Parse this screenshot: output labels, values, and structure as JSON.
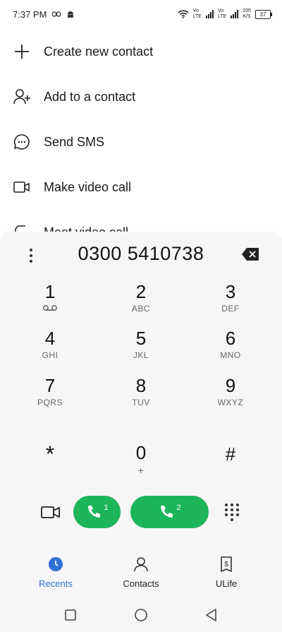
{
  "status_bar": {
    "time": "7:37 PM",
    "volte1": "Vo",
    "lte1": "LTE",
    "volte2": "Vo",
    "lte2": "LTE",
    "speed": "205",
    "speed_unit": "K/S",
    "battery": "37"
  },
  "menu": {
    "items": [
      {
        "label": "Create new contact",
        "icon": "plus-icon"
      },
      {
        "label": "Add to a contact",
        "icon": "add-person-icon"
      },
      {
        "label": "Send SMS",
        "icon": "chat-bubble-icon"
      },
      {
        "label": "Make video call",
        "icon": "video-camera-icon"
      },
      {
        "label": "Meet video call",
        "icon": "meet-video-icon"
      }
    ]
  },
  "dialer": {
    "number": "0300 5410738",
    "keys": [
      {
        "digit": "1",
        "letters": ""
      },
      {
        "digit": "2",
        "letters": "ABC"
      },
      {
        "digit": "3",
        "letters": "DEF"
      },
      {
        "digit": "4",
        "letters": "GHI"
      },
      {
        "digit": "5",
        "letters": "JKL"
      },
      {
        "digit": "6",
        "letters": "MNO"
      },
      {
        "digit": "7",
        "letters": "PQRS"
      },
      {
        "digit": "8",
        "letters": "TUV"
      },
      {
        "digit": "9",
        "letters": "WXYZ"
      },
      {
        "digit": "*",
        "letters": ""
      },
      {
        "digit": "0",
        "letters": "+"
      },
      {
        "digit": "#",
        "letters": ""
      }
    ],
    "call_sim1": "1",
    "call_sim2": "2",
    "accent_color": "#1db55b"
  },
  "tabs": [
    {
      "label": "Recents",
      "icon": "clock-icon",
      "active": true
    },
    {
      "label": "Contacts",
      "icon": "person-icon",
      "active": false
    },
    {
      "label": "ULife",
      "icon": "dollar-tag-icon",
      "active": false
    }
  ],
  "colors": {
    "active_tab": "#2f6fd6",
    "panel_bg": "#f6f6f6"
  }
}
